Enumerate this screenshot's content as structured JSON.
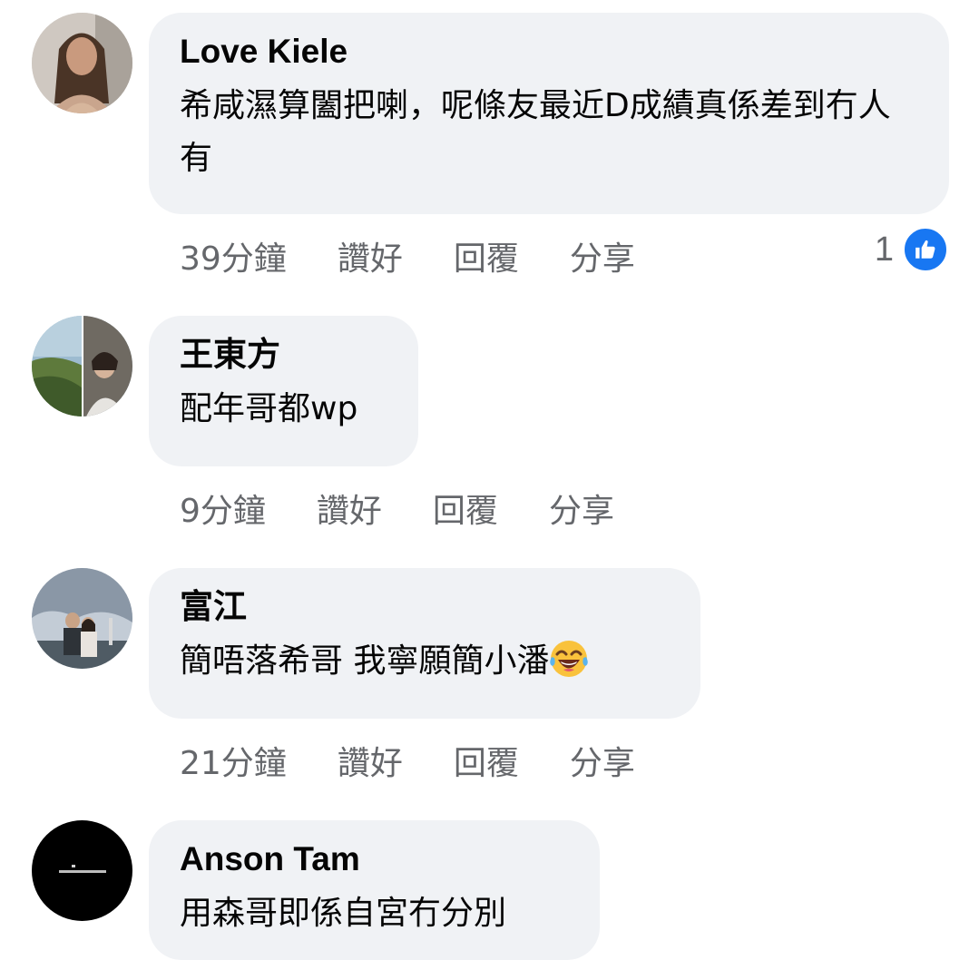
{
  "comments": [
    {
      "author": "Love Kiele",
      "text": "希咸濕算闔把喇，呢條友最近D成績真係差到冇人有",
      "time": "39分鐘",
      "like": "讚好",
      "reply": "回覆",
      "share": "分享",
      "reaction_count": "1",
      "reaction_icon": "thumbs-up-icon",
      "avatar": "profile-photo-woman"
    },
    {
      "author": "王東方",
      "text": "配年哥都wp",
      "time": "9分鐘",
      "like": "讚好",
      "reply": "回覆",
      "share": "分享",
      "avatar": "profile-photo-coast-couple"
    },
    {
      "author": "富江",
      "text": "簡唔落希哥 我寧願簡小潘",
      "emoji": "tears-of-joy-emoji",
      "time": "21分鐘",
      "like": "讚好",
      "reply": "回覆",
      "share": "分享",
      "avatar": "profile-photo-couple-sky"
    },
    {
      "author": "Anson Tam",
      "text": "用森哥即係自宮冇分別",
      "avatar": "profile-photo-black-text"
    }
  ],
  "colors": {
    "bubble": "#f0f2f5",
    "meta_text": "#65676b",
    "like_blue": "#1877f2",
    "text": "#050505"
  }
}
